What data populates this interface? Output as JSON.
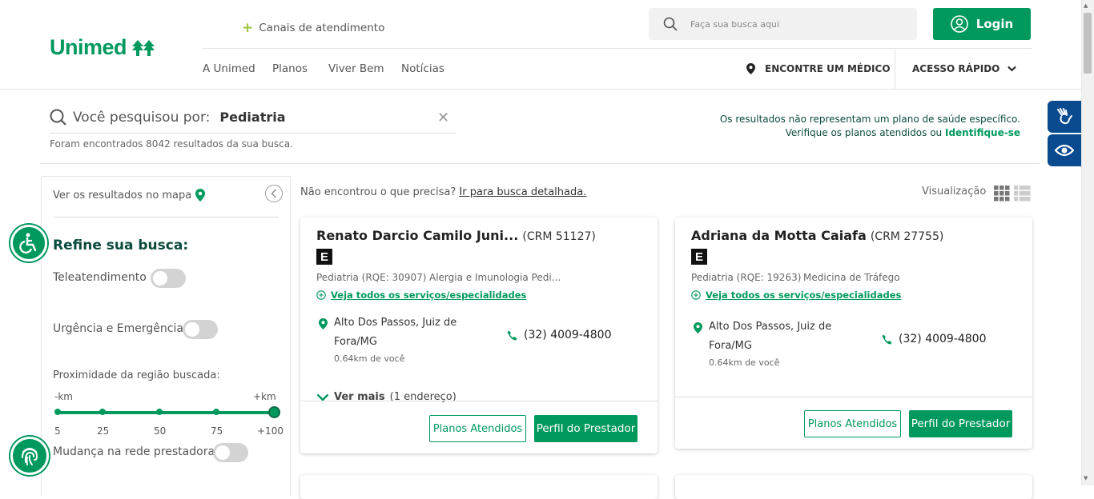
{
  "header": {
    "logo_text": "Unimed",
    "canais_label": "Canais de atendimento",
    "nav": [
      "A Unimed",
      "Planos",
      "Viver Bem",
      "Notícias"
    ],
    "search_placeholder": "Faça sua busca aqui",
    "login_label": "Login",
    "encontre_label": "ENCONTRE UM MÉDICO",
    "acesso_label": "ACESSO RÁPIDO"
  },
  "search_summary": {
    "prefix": "Você pesquisou por:",
    "term": "Pediatria",
    "found_text": "Foram encontrados 8042 resultados da sua busca.",
    "disclaimer_line1": "Os resultados não representam um plano de saúde específico.",
    "disclaimer_line2_prefix": "Verifique os planos atendidos ou ",
    "disclaimer_link": "Identifique-se"
  },
  "sidebar": {
    "map_link": "Ver os resultados no mapa",
    "refine_title": "Refine sua busca:",
    "filters": {
      "teleatendimento": "Teleatendimento",
      "urgencia": "Urgência e Emergência",
      "mudanca": "Mudança na rede prestadora"
    },
    "proximity_label": "Proximidade da região buscada:",
    "km_min": "-km",
    "km_max": "+km",
    "ticks": [
      "5",
      "25",
      "50",
      "75",
      "+100"
    ],
    "slider_selected": "+100"
  },
  "results": {
    "not_found_prefix": "Não encontrou o que precisa? ",
    "not_found_link": "Ir para busca detalhada.",
    "visualizacao_label": "Visualização",
    "cards": [
      {
        "name": "Renato Darcio Camilo Juni...",
        "crm": "(CRM 51127)",
        "badge": "E",
        "spec1": "Pediatria (RQE: 30907)",
        "spec2": "Alergia e Imunologia Pedi...",
        "see_all": "Veja todos os serviços/especialidades",
        "address": "Alto Dos Passos, Juiz de Fora/MG",
        "distance": "0.64km de você",
        "phone": "(32) 4009-4800",
        "ver_mais": "Ver mais",
        "ver_mais_count": "(1 endereço)",
        "btn_planos": "Planos Atendidos",
        "btn_perfil": "Perfil do Prestador"
      },
      {
        "name": "Adriana da Motta Caiafa",
        "crm": "(CRM 27755)",
        "badge": "E",
        "spec1": "Pediatria (RQE: 19263)",
        "spec2": "Medicina de Tráfego",
        "see_all": "Veja todos os serviços/especialidades",
        "address": "Alto Dos Passos, Juiz de Fora/MG",
        "distance": "0.64km de você",
        "phone": "(32) 4009-4800",
        "btn_planos": "Planos Atendidos",
        "btn_perfil": "Perfil do Prestador"
      }
    ]
  },
  "colors": {
    "brand_green": "#00995d",
    "dark_green": "#0b4a3e",
    "accessibility_blue": "#0a4b8f"
  }
}
